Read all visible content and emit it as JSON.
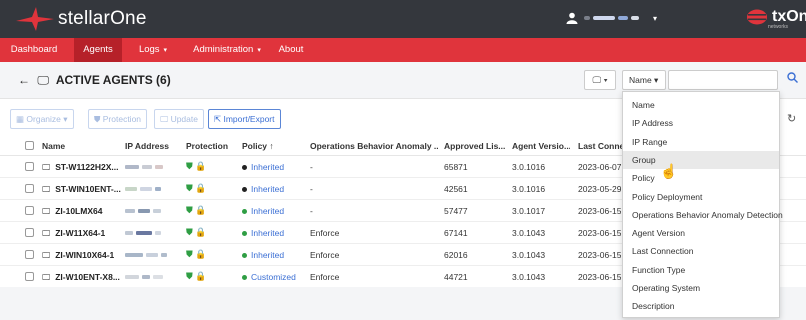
{
  "app": {
    "logo_text": "stellarOne",
    "brand_text": "txOne",
    "brand_sub": "networks",
    "colors": {
      "topbar": "#34373d",
      "navbar": "#e0343c",
      "nav_active": "#b62129",
      "accent": "#3b6fd4",
      "protection": "#2f9e44"
    }
  },
  "nav": {
    "items": [
      {
        "label": "Dashboard",
        "caret": ""
      },
      {
        "label": "Agents",
        "caret": "",
        "active": true
      },
      {
        "label": "Logs",
        "caret": "▾"
      },
      {
        "label": "Administration",
        "caret": "▾"
      },
      {
        "label": "About",
        "caret": ""
      }
    ]
  },
  "page": {
    "back_icon": "←",
    "title_icon": "monitor-icon",
    "title": "ACTIVE AGENTS (6)",
    "view_btn": "🖵 ▾",
    "filter_select": "Name ▾",
    "search_placeholder": ""
  },
  "toolbar": {
    "organize": "Organize ▾",
    "protection": "Protection",
    "update": "Update",
    "import_export": "Import/Export"
  },
  "table": {
    "headers": [
      "Name",
      "IP Address",
      "Protection",
      "Policy ↑",
      "Operations Behavior Anomaly ...",
      "Approved Lis...",
      "Agent Versio...",
      "Last Conne"
    ],
    "rows": [
      {
        "name": "ST-W1122H2X...",
        "protection": "✔ 🔒",
        "policy": "Inherited",
        "policy_color": "#222222",
        "oba": "-",
        "approved": "65871",
        "version": "3.0.1016",
        "last": "2023-06-07"
      },
      {
        "name": "ST-WIN10ENT-...",
        "protection": "✔ 🔒",
        "policy": "Inherited",
        "policy_color": "#222222",
        "oba": "-",
        "approved": "42561",
        "version": "3.0.1016",
        "last": "2023-05-29"
      },
      {
        "name": "ZI-10LMX64",
        "protection": "✔ 🔒",
        "policy": "Inherited",
        "policy_color": "#2f9e44",
        "oba": "-",
        "approved": "57477",
        "version": "3.0.1017",
        "last": "2023-06-15"
      },
      {
        "name": "ZI-W11X64-1",
        "protection": "✔ 🔒",
        "policy": "Inherited",
        "policy_color": "#2f9e44",
        "oba": "Enforce",
        "approved": "67141",
        "version": "3.0.1043",
        "last": "2023-06-15"
      },
      {
        "name": "ZI-WIN10X64-1",
        "protection": "✔ 🔒",
        "policy": "Inherited",
        "policy_color": "#2f9e44",
        "oba": "Enforce",
        "approved": "62016",
        "version": "3.0.1043",
        "last": "2023-06-15"
      },
      {
        "name": "ZI-W10ENT-X8...",
        "protection": "✔ 🔒",
        "policy": "Customized",
        "policy_color": "#2f9e44",
        "oba": "Enforce",
        "approved": "44721",
        "version": "3.0.1043",
        "last": "2023-06-15"
      }
    ]
  },
  "dropdown": {
    "items": [
      "Name",
      "IP Address",
      "IP Range",
      "Group",
      "Policy",
      "Policy Deployment",
      "Operations Behavior Anomaly Detection",
      "Agent Version",
      "Last Connection",
      "Function Type",
      "Operating System",
      "Description"
    ],
    "hover_index": 3
  }
}
